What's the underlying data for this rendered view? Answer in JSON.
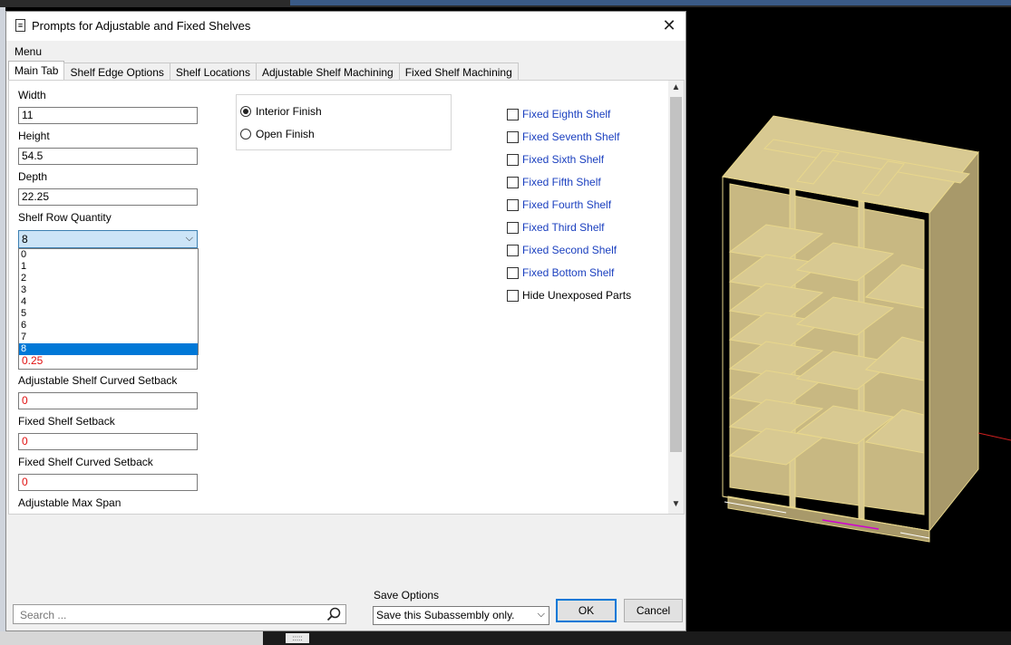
{
  "dialog": {
    "title": "Prompts for Adjustable and Fixed Shelves",
    "close_glyph": "✕",
    "menu_label": "Menu"
  },
  "tabs": [
    {
      "label": "Main Tab",
      "active": true
    },
    {
      "label": "Shelf Edge Options",
      "active": false
    },
    {
      "label": "Shelf Locations",
      "active": false
    },
    {
      "label": "Adjustable Shelf Machining",
      "active": false
    },
    {
      "label": "Fixed Shelf Machining",
      "active": false
    }
  ],
  "fields": {
    "width": {
      "label": "Width",
      "value": "11"
    },
    "height": {
      "label": "Height",
      "value": "54.5"
    },
    "depth": {
      "label": "Depth",
      "value": "22.25"
    },
    "shelf_row_qty": {
      "label": "Shelf Row Quantity",
      "value": "8"
    },
    "adj_setback_value": "0.25",
    "adj_curved_setback": {
      "label": "Adjustable Shelf Curved Setback",
      "value": "0"
    },
    "fixed_setback": {
      "label": "Fixed Shelf Setback",
      "value": "0"
    },
    "fixed_curved_setback": {
      "label": "Fixed Shelf Curved Setback",
      "value": "0"
    },
    "adj_max_span": {
      "label": "Adjustable Max Span"
    }
  },
  "dropdown_options": [
    "0",
    "1",
    "2",
    "3",
    "4",
    "5",
    "6",
    "7",
    "8"
  ],
  "dropdown_selected": "8",
  "finish": {
    "interior": "Interior Finish",
    "open": "Open Finish",
    "selected": "interior"
  },
  "checkboxes": [
    {
      "label": "Fixed Eighth Shelf",
      "checked": false
    },
    {
      "label": "Fixed Seventh Shelf",
      "checked": false
    },
    {
      "label": "Fixed Sixth Shelf",
      "checked": false
    },
    {
      "label": "Fixed Fifth Shelf",
      "checked": false
    },
    {
      "label": "Fixed Fourth Shelf",
      "checked": false
    },
    {
      "label": "Fixed Third Shelf",
      "checked": false
    },
    {
      "label": "Fixed Second Shelf",
      "checked": false
    },
    {
      "label": "Fixed Bottom Shelf",
      "checked": false
    },
    {
      "label": "Hide Unexposed Parts",
      "checked": false
    }
  ],
  "footer": {
    "search_placeholder": "Search ...",
    "save_options_label": "Save Options",
    "save_options_value": "Save this Subassembly only.",
    "ok_label": "OK",
    "cancel_label": "Cancel"
  },
  "colors": {
    "accent": "#0078d7",
    "link_blue": "#1a3fbf",
    "error_red": "#e01010",
    "cabinet_fill": "#c8b882",
    "cabinet_edge": "#e6d68a"
  }
}
